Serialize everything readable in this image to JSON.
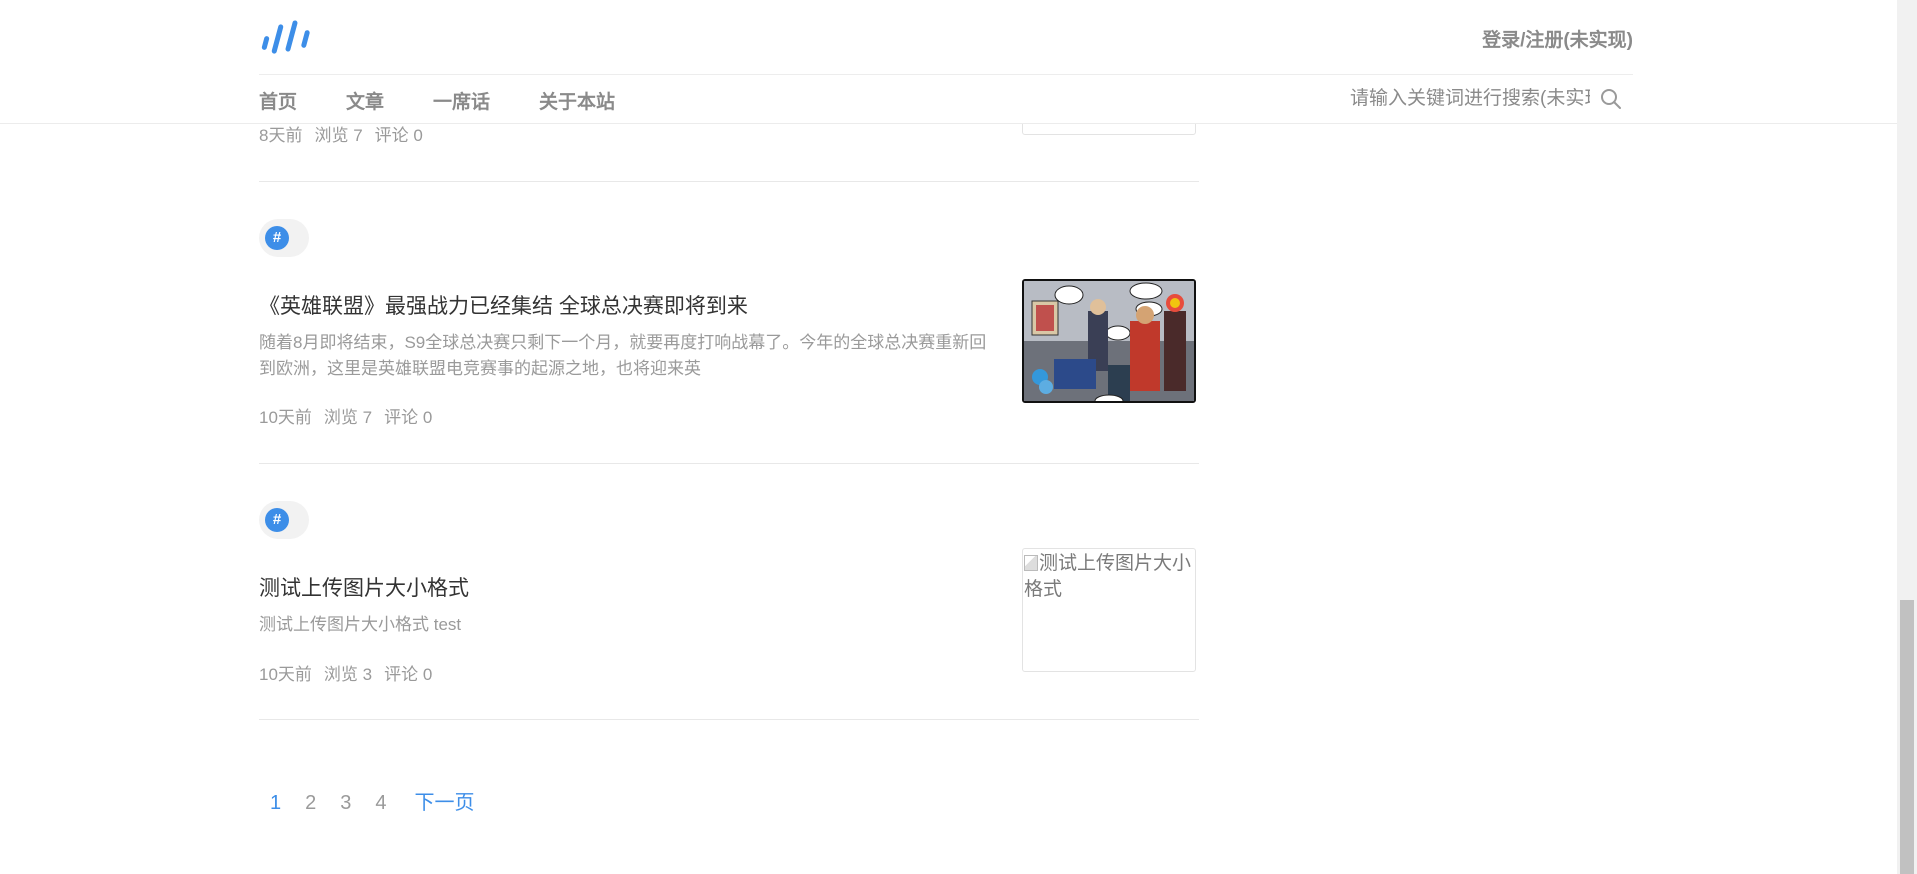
{
  "header": {
    "login_label": "登录/注册(未实现)",
    "nav": [
      {
        "label": "首页"
      },
      {
        "label": "文章"
      },
      {
        "label": "一席话"
      },
      {
        "label": "关于本站"
      }
    ],
    "search_placeholder": "请输入关键词进行搜索(未实现)",
    "accent_color": "#3d8ee8"
  },
  "articles": [
    {
      "meta": {
        "time": "8天前",
        "views": "浏览 7",
        "comments": "评论 0"
      }
    },
    {
      "topic_icon": "#",
      "title": "《英雄联盟》最强战力已经集结 全球总决赛即将到来",
      "summary": "随着8月即将结束，S9全球总决赛只剩下一个月，就要再度打响战幕了。今年的全球总决赛重新回到欧洲，这里是英雄联盟电竞赛事的起源之地，也将迎来英",
      "meta": {
        "time": "10天前",
        "views": "浏览 7",
        "comments": "评论 0"
      },
      "thumbnail": "comic-image"
    },
    {
      "topic_icon": "#",
      "title": "测试上传图片大小格式",
      "summary": "测试上传图片大小格式 test",
      "meta": {
        "time": "10天前",
        "views": "浏览 3",
        "comments": "评论 0"
      },
      "thumbnail_alt": "测试上传图片大小格式"
    }
  ],
  "pagination": {
    "pages": [
      "1",
      "2",
      "3",
      "4"
    ],
    "current": "1",
    "next_label": "下一页"
  }
}
